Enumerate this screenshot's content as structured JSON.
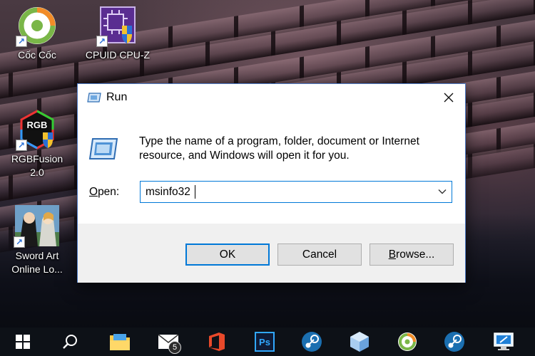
{
  "desktop": {
    "icons": [
      {
        "label": "Cốc Cốc",
        "icon": "coccoc-browser-icon"
      },
      {
        "label": "CPUID CPU-Z",
        "icon": "cpuz-icon"
      },
      {
        "label": "RGBFusion 2.0",
        "icon": "rgb-fusion-icon"
      },
      {
        "label": "Sword Art Online Lo...",
        "icon": "sword-art-online-icon"
      }
    ]
  },
  "dialog": {
    "title": "Run",
    "description": "Type the name of a program, folder, document or Internet resource, and Windows will open it for you.",
    "open_label_mnemonic": "O",
    "open_label_rest": "pen:",
    "open_value": "msinfo32",
    "buttons": {
      "ok": "OK",
      "cancel": "Cancel",
      "browse_mnemonic": "B",
      "browse_rest": "rowse..."
    }
  },
  "taskbar": {
    "items": [
      {
        "icon": "windows-start-icon"
      },
      {
        "icon": "search-icon"
      },
      {
        "icon": "file-explorer-icon"
      },
      {
        "icon": "mail-icon",
        "badge": "5"
      },
      {
        "icon": "office-icon"
      },
      {
        "icon": "photoshop-icon",
        "label": "Ps"
      },
      {
        "icon": "steam-icon"
      },
      {
        "icon": "virtualbox-icon"
      },
      {
        "icon": "coccoc-browser-icon"
      },
      {
        "icon": "steam-icon"
      },
      {
        "icon": "remote-desktop-icon"
      }
    ]
  },
  "colors": {
    "accent": "#0078d7",
    "dialog_footer": "#f0f0f0",
    "taskbar": "#0d1117"
  }
}
